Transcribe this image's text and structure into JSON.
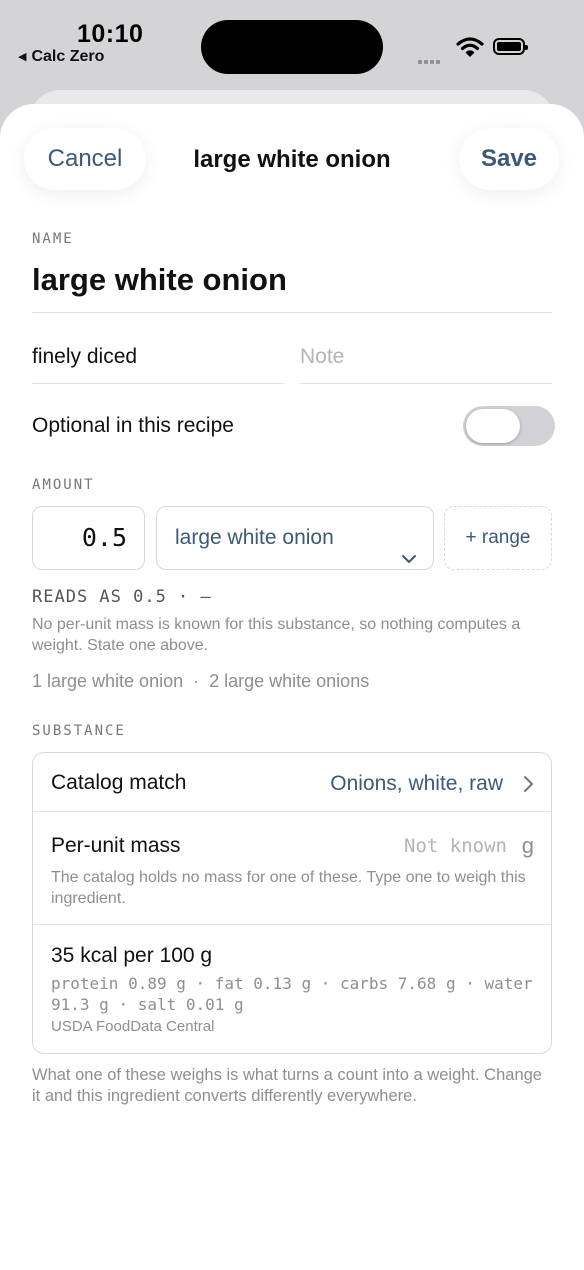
{
  "status_bar": {
    "time": "10:10",
    "back_label": "Calc Zero"
  },
  "nav": {
    "cancel": "Cancel",
    "title": "large white onion",
    "save": "Save"
  },
  "name_section": {
    "label": "NAME",
    "value": "large white onion"
  },
  "prep": {
    "value": "finely diced"
  },
  "note": {
    "placeholder": "Note"
  },
  "optional": {
    "label": "Optional in this recipe",
    "on": false
  },
  "amount_section": {
    "label": "AMOUNT",
    "quantity": "0.5",
    "unit": "large white onion",
    "range_button": "+ range",
    "reads_as": "READS AS 0.5 · —",
    "helper": "No per-unit mass is known for this substance, so nothing computes a weight. State one above.",
    "plurals": "1 large white onion  ·  2 large white onions"
  },
  "substance_section": {
    "label": "SUBSTANCE",
    "catalog_label": "Catalog match",
    "catalog_value": "Onions, white, raw",
    "mass_label": "Per-unit mass",
    "mass_placeholder": "Not known",
    "mass_unit": "g",
    "mass_helper": "The catalog holds no mass for one of these. Type one to weigh this ingredient.",
    "kcal": "35 kcal per 100 g",
    "nutrients": "protein 0.89 g · fat 0.13 g · carbs 7.68 g · water 91.3 g · salt 0.01 g",
    "source": "USDA FoodData Central"
  },
  "footer_note": "What one of these weighs is what turns a count into a weight. Change it and this ingredient converts differently everywhere."
}
